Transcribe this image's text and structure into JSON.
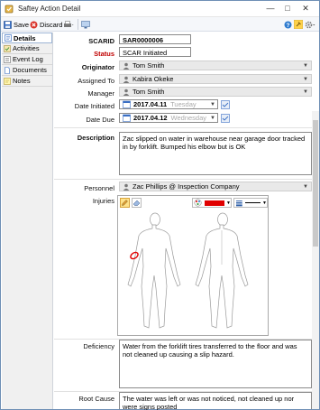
{
  "window": {
    "title": "Saftey Action Detail"
  },
  "toolbar": {
    "save_label": "Save",
    "discard_label": "Discard"
  },
  "sidebar": {
    "items": [
      {
        "label": "Details",
        "icon": "details-icon"
      },
      {
        "label": "Activities",
        "icon": "activities-icon"
      },
      {
        "label": "Event Log",
        "icon": "event-log-icon"
      },
      {
        "label": "Documents",
        "icon": "documents-icon"
      },
      {
        "label": "Notes",
        "icon": "notes-icon"
      }
    ]
  },
  "form": {
    "scarid_label": "SCARID",
    "scarid_value": "SAR0000006",
    "status_label": "Status",
    "status_value": "SCAR Initiated",
    "originator_label": "Originator",
    "originator_value": "Tom Smith",
    "assigned_label": "Assigned To",
    "assigned_value": "Kabira Okeke",
    "manager_label": "Manager",
    "manager_value": "Tom Smith",
    "date_initiated_label": "Date Initiated",
    "date_initiated_value": "2017.04.11",
    "date_initiated_day": "Tuesday",
    "date_due_label": "Date Due",
    "date_due_value": "2017.04.12",
    "date_due_day": "Wednesday",
    "description_label": "Description",
    "description_value": "Zac slipped on water in warehouse near garage door tracked in by forklift. Bumped his elbow but is OK",
    "personnel_label": "Personnel",
    "personnel_value": "Zac Phillips @ Inspection Company",
    "injuries_label": "Injuries",
    "deficiency_label": "Deficiency",
    "deficiency_value": "Water from the forklift tires transferred to the floor and was not cleaned up causing a slip hazard.",
    "root_cause_label": "Root Cause",
    "root_cause_value": "The water was left or was not noticed, not cleaned up nor were signs posted"
  },
  "colors": {
    "accent": "#2e7bcf",
    "status_red": "#c00000",
    "pen_red": "#e00000"
  }
}
